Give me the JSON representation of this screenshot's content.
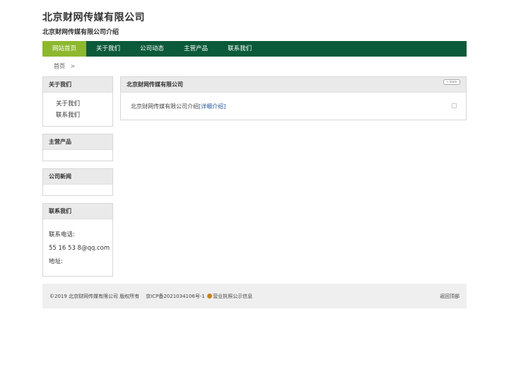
{
  "header": {
    "title": "北京财网传媒有限公司",
    "subtitle": "北京财网传媒有限公司介绍"
  },
  "nav": {
    "items": [
      "网站首页",
      "关于我们",
      "公司动态",
      "主营产品",
      "联系我们"
    ]
  },
  "breadcrumb": {
    "home": "首页",
    "separator": ">"
  },
  "sidebar": {
    "about": {
      "title": "关于我们",
      "links": [
        "关于我们",
        "联系我们"
      ]
    },
    "products": {
      "title": "主营产品"
    },
    "news": {
      "title": "公司新闻"
    },
    "contact": {
      "title": "联系我们",
      "phone_label": "联系电话:",
      "email": "55 16 53 8@qq.com",
      "address_label": "地址:"
    }
  },
  "main": {
    "title": "北京财网传媒有限公司",
    "more": "» more",
    "intro_text": "北京财网传媒有限公司介绍",
    "detail_link": "[详细介绍]"
  },
  "footer": {
    "copyright": "©2019 北京财网传媒有限公司 版权所有",
    "icp": "京ICP备2021034106号-1",
    "license": "营业执照公示信息",
    "back_top": "返回顶部"
  },
  "colors": {
    "nav_bg": "#0b5a3a",
    "nav_active": "#8db82e",
    "link": "#1f4f9a"
  }
}
